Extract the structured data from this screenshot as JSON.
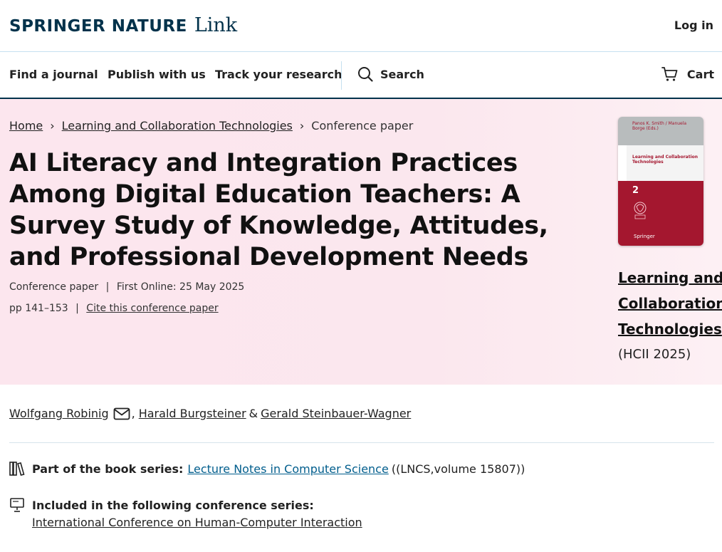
{
  "header": {
    "brand": "SPRINGER NATURE",
    "product": "Link",
    "login": "Log in"
  },
  "nav": {
    "items": [
      "Find a journal",
      "Publish with us",
      "Track your research"
    ],
    "search": "Search",
    "cart": "Cart"
  },
  "breadcrumb": {
    "home": "Home",
    "book": "Learning and Collaboration Technologies",
    "current": "Conference paper"
  },
  "article": {
    "title": "AI Literacy and Integration Practices Among Digital Education Teachers: A Survey Study of Knowledge, Attitudes, and Professional Development Needs",
    "type": "Conference paper",
    "first_online": "First Online: 25 May 2025",
    "pages": "pp 141–153",
    "cite": "Cite this conference paper"
  },
  "book": {
    "title_line1": "Learning and",
    "title_line2": "Collaboration",
    "title_line3": "Technologies",
    "subtitle": "(HCII 2025)",
    "cover": {
      "editors": "Panos K. Smith / Manuela Borge (Eds.)",
      "title": "Learning and Collaboration Technologies",
      "part": "2",
      "publisher": "Springer"
    }
  },
  "authors": {
    "list": [
      "Wolfgang Robinig",
      "Harald Burgsteiner",
      "Gerald Steinbauer-Wagner"
    ],
    "comma": ",",
    "and": "&"
  },
  "series": {
    "label": "Part of the book series:",
    "name": "Lecture Notes in Computer Science",
    "extra": "((LNCS,volume 15807))"
  },
  "conference": {
    "label": "Included in the following conference series:",
    "name": "International Conference on Human-Computer Interaction"
  },
  "colors": {
    "brand": "#01324b",
    "link": "#025e8d",
    "hero_bg": "#fce6ee",
    "cover_red": "#a4172f"
  }
}
